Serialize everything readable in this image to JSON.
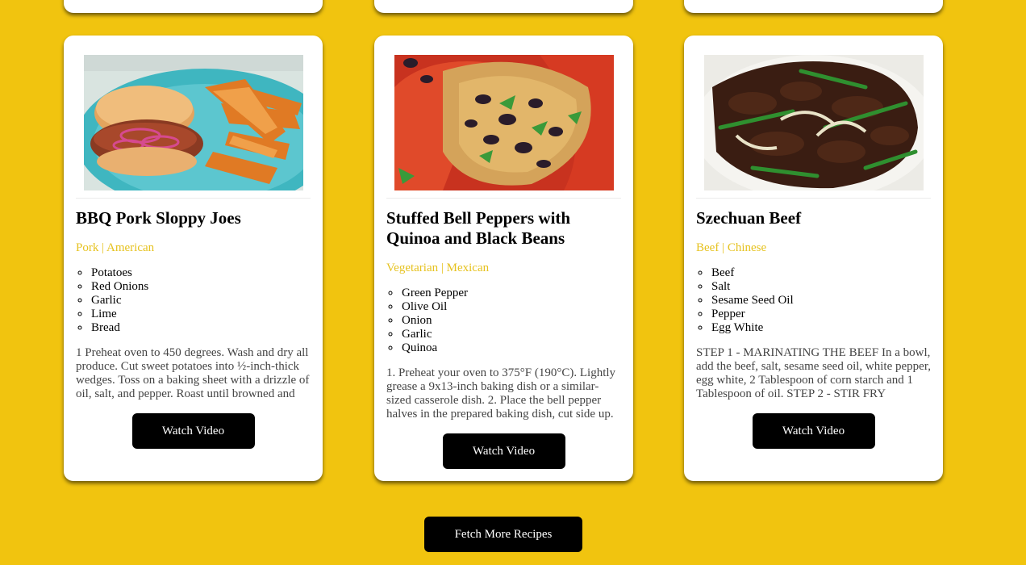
{
  "recipes": [
    {
      "title": "BBQ Pork Sloppy Joes",
      "tags": "Pork | American",
      "ingredients": [
        "Potatoes",
        "Red Onions",
        "Garlic",
        "Lime",
        "Bread"
      ],
      "instructions": "1 Preheat oven to 450 degrees. Wash and dry all produce. Cut sweet potatoes into ½-inch-thick wedges. Toss on a baking sheet with a drizzle of oil, salt, and pepper. Roast until browned and",
      "button": "Watch Video",
      "image_icon": "sloppy-joe-photo"
    },
    {
      "title": "Stuffed Bell Peppers with Quinoa and Black Beans",
      "tags": "Vegetarian | Mexican",
      "ingredients": [
        "Green Pepper",
        "Olive Oil",
        "Onion",
        "Garlic",
        "Quinoa"
      ],
      "instructions": "1. Preheat your oven to 375°F (190°C). Lightly grease a 9x13-inch baking dish or a similar-sized casserole dish. 2. Place the bell pepper halves in the prepared baking dish, cut side up.",
      "button": "Watch Video",
      "image_icon": "stuffed-peppers-photo"
    },
    {
      "title": "Szechuan Beef",
      "tags": "Beef | Chinese",
      "ingredients": [
        "Beef",
        "Salt",
        "Sesame Seed Oil",
        "Pepper",
        "Egg White"
      ],
      "instructions": "STEP 1 - MARINATING THE BEEF In a bowl, add the beef, salt, sesame seed oil, white pepper, egg white, 2 Tablespoon of corn starch and 1 Tablespoon of oil. STEP 2 - STIR FRY",
      "button": "Watch Video",
      "image_icon": "szechuan-beef-photo"
    }
  ],
  "fetch_button": "Fetch More Recipes",
  "colors": {
    "background": "#f1c40f",
    "tag_text": "#e6c21f",
    "button": "#000000"
  }
}
